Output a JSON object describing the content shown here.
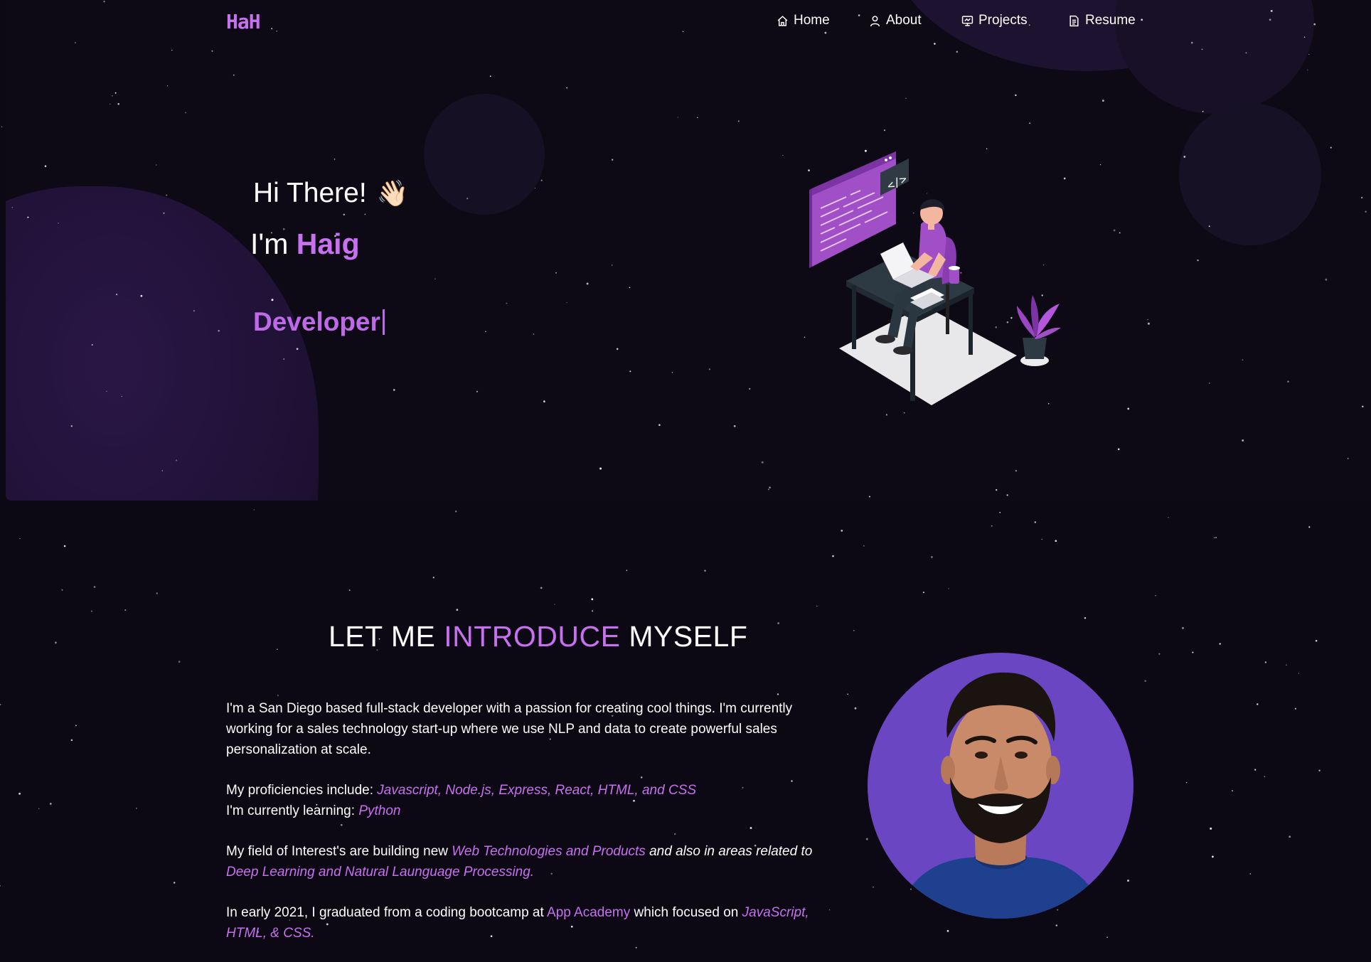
{
  "nav": {
    "logo": "HaH",
    "items": [
      {
        "label": "Home",
        "icon": "home-icon"
      },
      {
        "label": "About",
        "icon": "user-icon"
      },
      {
        "label": "Projects",
        "icon": "projects-icon"
      },
      {
        "label": "Resume",
        "icon": "document-icon"
      }
    ]
  },
  "hero": {
    "greeting": "Hi There!",
    "wave_emoji": "👋🏻",
    "im_prefix": "I'm ",
    "name": "Haig",
    "role": "Developer"
  },
  "about": {
    "title_part1": "LET ME ",
    "title_accent": "INTRODUCE",
    "title_part2": " MYSELF",
    "p1": "I'm a San Diego based full-stack developer with a passion for creating cool things. I'm currently working for a sales technology start-up where we use NLP and data to create powerful sales personalization at scale.",
    "proficiencies_label": "My proficiencies include: ",
    "proficiencies": "Javascript, Node.js, Express, React, HTML, and CSS",
    "learning_label": "I'm currently learning: ",
    "learning": "Python",
    "interest_label": "My field of Interest's are building new ",
    "interest_1": "Web Technologies and Products",
    "interest_mid": " and also in areas related to ",
    "interest_2": "Deep Learning and Natural Launguage Processing.",
    "bootcamp_pre": "In early 2021, I graduated from a coding bootcamp at ",
    "bootcamp_school": "App Academy",
    "bootcamp_mid": " which focused on ",
    "bootcamp_stack": "JavaScript, HTML, & CSS."
  },
  "colors": {
    "accent": "#c770f0",
    "background": "#0c0814",
    "avatar_bg": "#6a46c2"
  }
}
